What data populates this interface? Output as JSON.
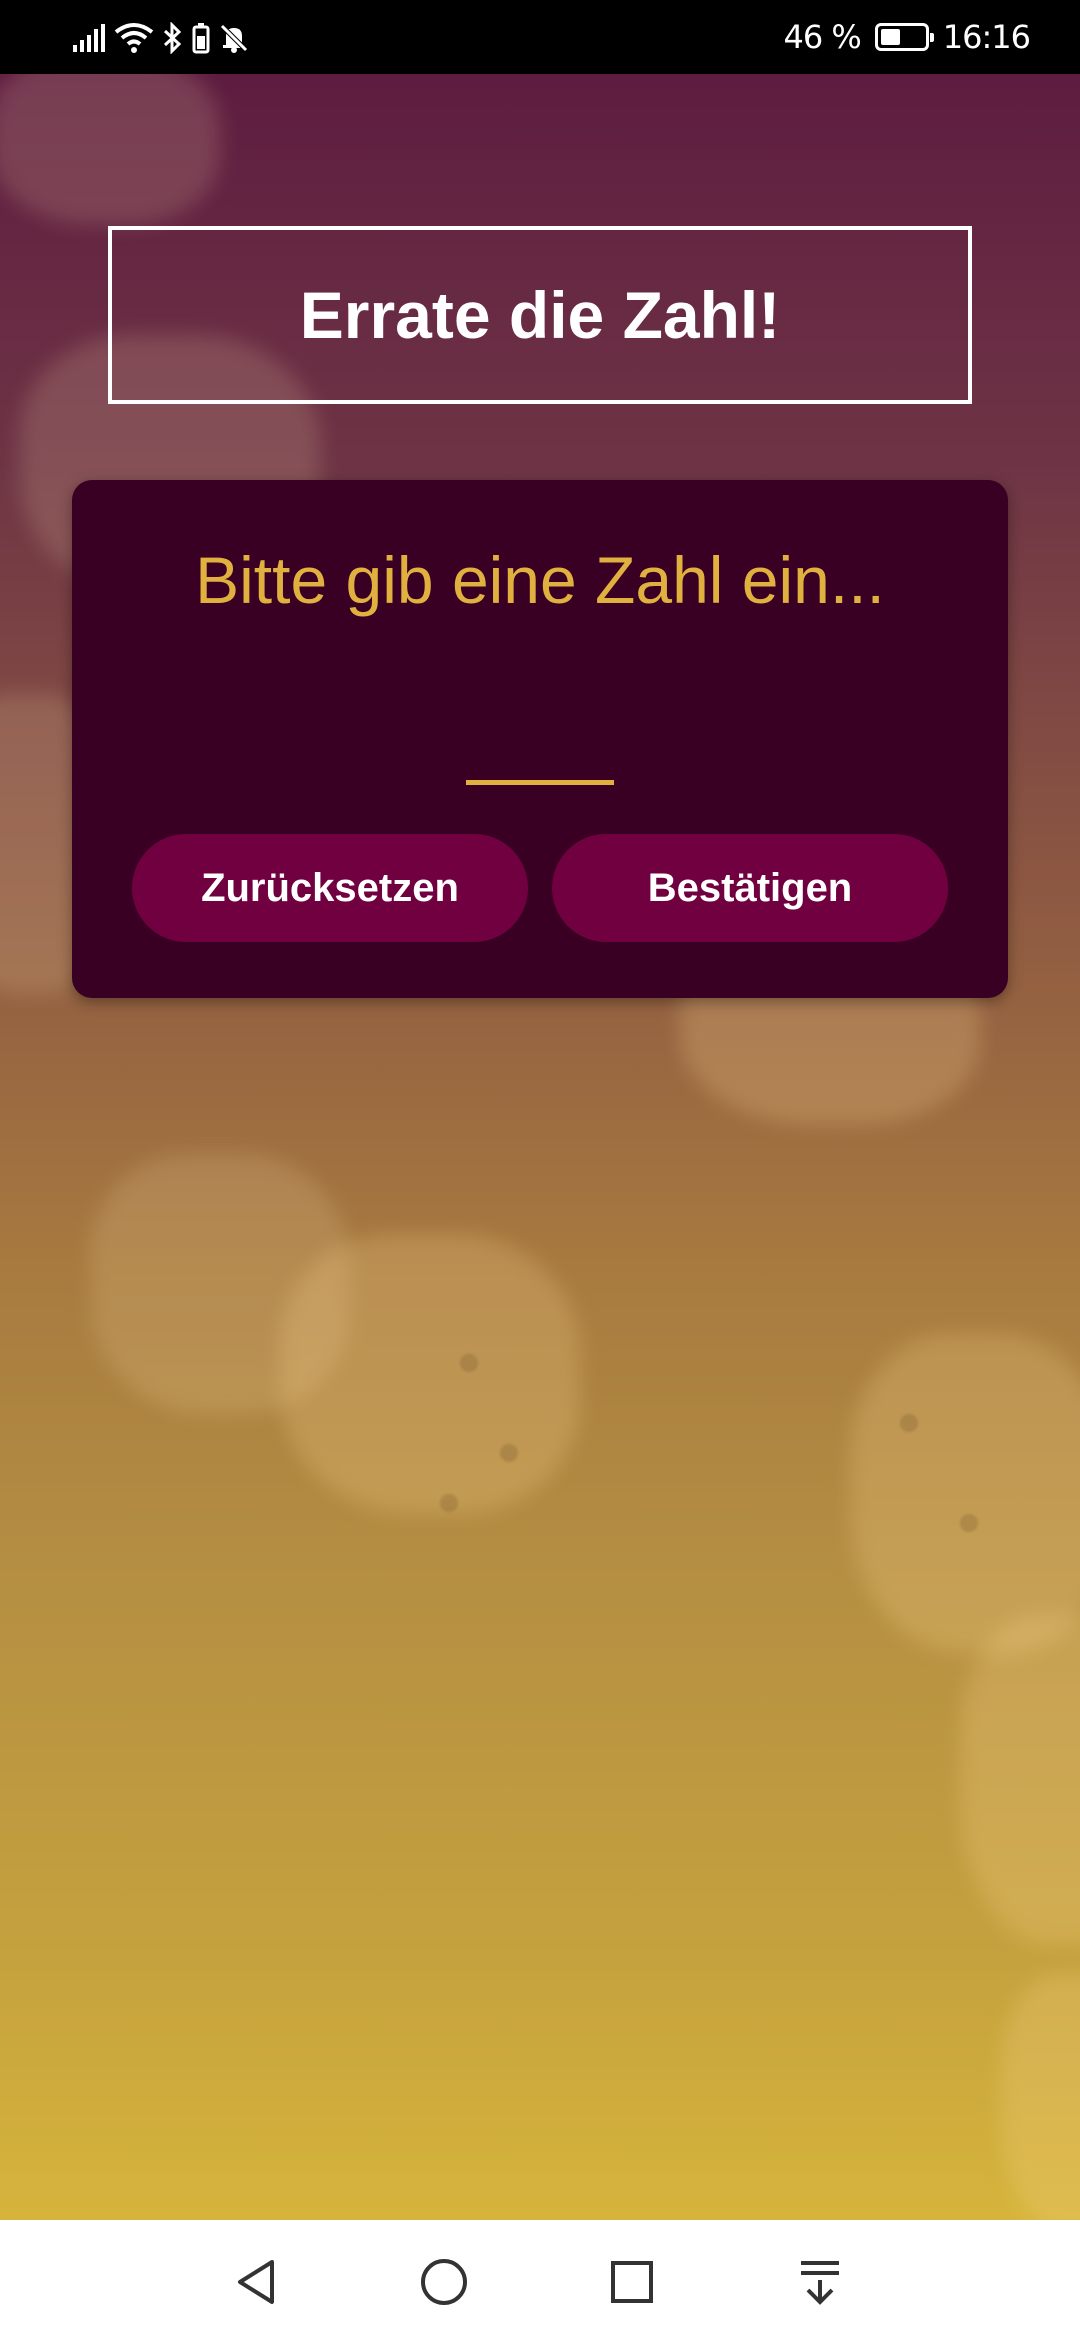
{
  "status_bar": {
    "battery_percent_label": "46 %",
    "battery_level": 0.46,
    "time": "16:16",
    "icons": [
      "signal-icon",
      "wifi-icon",
      "bluetooth-icon",
      "battery-small-icon",
      "bell-off-icon"
    ]
  },
  "game": {
    "title": "Errate die Zahl!",
    "prompt": "Bitte gib eine Zahl ein...",
    "input_value": "",
    "reset_label": "Zurücksetzen",
    "confirm_label": "Bestätigen"
  },
  "colors": {
    "card_background": "#3a0024",
    "button_background": "#710040",
    "accent_gold": "#e0b13f",
    "title_border": "#ffffff"
  },
  "nav_bar": {
    "icons": [
      "back-icon",
      "home-icon",
      "recents-icon",
      "notification-pull-icon"
    ]
  }
}
